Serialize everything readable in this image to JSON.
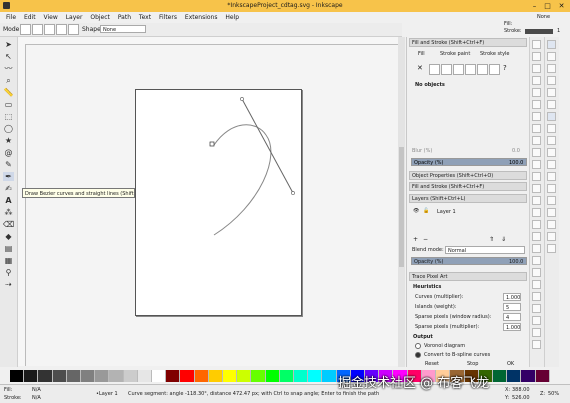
{
  "window": {
    "title": "*InkscapeProject_cdtag.svg - Inkscape",
    "minimize": "–",
    "maximize": "□",
    "close": "✕"
  },
  "menu": [
    "File",
    "Edit",
    "View",
    "Layer",
    "Object",
    "Path",
    "Text",
    "Filters",
    "Extensions",
    "Help"
  ],
  "controls": {
    "mode_label": "Mode:",
    "shape_label": "Shape:",
    "shape_value": "None"
  },
  "fill_indicator": {
    "fill_label": "Fill:",
    "stroke_label": "Stroke:",
    "none": "None",
    "stroke_width": "1"
  },
  "tooltip": "Draw Bezier curves and straight lines (Shift+F6)",
  "fill_stroke": {
    "header": "Fill and Stroke (Shift+Ctrl+F)",
    "tabs": [
      "Fill",
      "Stroke paint",
      "Stroke style"
    ],
    "no_objects": "No objects",
    "blur_label": "Blur (%)",
    "blur_value": "0.0",
    "opacity_label": "Opacity (%)",
    "opacity_value": "100.0"
  },
  "docked": {
    "object_props": "Object Properties (Shift+Ctrl+O)",
    "fill_stroke": "Fill and Stroke (Shift+Ctrl+F)",
    "layers": "Layers (Shift+Ctrl+L)"
  },
  "layers": {
    "layer_name": "Layer 1",
    "blend_label": "Blend mode:",
    "blend_value": "Normal",
    "opacity_label": "Opacity (%)",
    "opacity_value": "100.0"
  },
  "trace": {
    "header": "Trace Pixel Art",
    "heuristics": "Heuristics",
    "curves_label": "Curves (multiplier):",
    "curves_value": "1.000",
    "islands_label": "Islands (weight):",
    "islands_value": "5",
    "sparse_w_label": "Sparse pixels (window radius):",
    "sparse_w_value": "4",
    "sparse_m_label": "Sparse pixels (multiplier):",
    "sparse_m_value": "1.000",
    "output": "Output",
    "voronoi": "Voronoi diagram",
    "bspline": "Convert to B-spline curves",
    "reset": "Reset",
    "stop": "Stop",
    "ok": "OK"
  },
  "status": {
    "fill_label": "Fill:",
    "stroke_label": "Stroke:",
    "na": "N/A",
    "layer": "•Layer 1",
    "message": "Curve segment: angle -118.30°, distance 472.47 px; with Ctrl to snap angle; Enter to finish the path",
    "x_label": "X:",
    "x_value": "388.00",
    "y_label": "Y:",
    "y_value": "526.00",
    "z_label": "Z:",
    "zoom": "50%"
  },
  "watermark": "掘金技术社区 @ 布客飞龙",
  "palette_colors": [
    "#000000",
    "#1a1a1a",
    "#333333",
    "#4d4d4d",
    "#666666",
    "#808080",
    "#999999",
    "#b3b3b3",
    "#cccccc",
    "#e6e6e6",
    "#ffffff",
    "#800000",
    "#ff0000",
    "#ff6600",
    "#ffcc00",
    "#ffff00",
    "#ccff00",
    "#66ff00",
    "#00ff00",
    "#00ff66",
    "#00ffcc",
    "#00ffff",
    "#00ccff",
    "#0066ff",
    "#0000ff",
    "#6600ff",
    "#cc00ff",
    "#ff00ff",
    "#ff0066",
    "#ff99cc",
    "#ffcc99",
    "#996633",
    "#663300",
    "#336600",
    "#006633",
    "#003366",
    "#330066",
    "#660033"
  ]
}
